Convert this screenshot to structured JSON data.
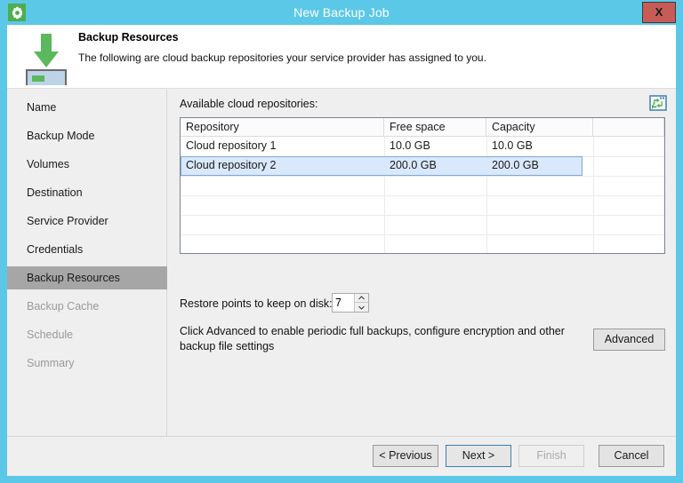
{
  "window": {
    "title": "New Backup Job",
    "app_icon": "gear-icon",
    "close_label": "X",
    "accent_color": "#5cc8e8",
    "close_color": "#c75b56"
  },
  "header": {
    "title": "Backup Resources",
    "description": "The following are cloud backup repositories your service provider has assigned to you.",
    "icon": "download-to-disk-icon"
  },
  "sidebar": {
    "items": [
      {
        "label": "Name",
        "state": "enabled"
      },
      {
        "label": "Backup Mode",
        "state": "enabled"
      },
      {
        "label": "Volumes",
        "state": "enabled"
      },
      {
        "label": "Destination",
        "state": "enabled"
      },
      {
        "label": "Service Provider",
        "state": "enabled"
      },
      {
        "label": "Credentials",
        "state": "enabled"
      },
      {
        "label": "Backup Resources",
        "state": "selected"
      },
      {
        "label": "Backup Cache",
        "state": "disabled"
      },
      {
        "label": "Schedule",
        "state": "disabled"
      },
      {
        "label": "Summary",
        "state": "disabled"
      }
    ]
  },
  "main": {
    "repositories_label": "Available cloud repositories:",
    "refresh_icon": "refresh-icon",
    "table": {
      "columns": [
        "Repository",
        "Free space",
        "Capacity",
        ""
      ],
      "rows": [
        {
          "repository": "Cloud repository 1",
          "free_space": "10.0 GB",
          "capacity": "10.0 GB",
          "selected": false
        },
        {
          "repository": "Cloud repository 2",
          "free_space": "200.0 GB",
          "capacity": "200.0 GB",
          "selected": true
        }
      ],
      "empty_rows": 5,
      "selection_color": "#d9e8fb"
    },
    "restore_points": {
      "label": "Restore points to keep on disk:",
      "value": "7",
      "spinner_up_icon": "chevron-up-icon",
      "spinner_down_icon": "chevron-down-icon"
    },
    "advanced": {
      "description": "Click Advanced to enable periodic full backups, configure encryption and other backup file settings",
      "button_label": "Advanced"
    }
  },
  "footer": {
    "buttons": [
      {
        "label": "< Previous",
        "state": "enabled"
      },
      {
        "label": "Next >",
        "state": "focused"
      },
      {
        "label": "Finish",
        "state": "disabled"
      },
      {
        "label": "Cancel",
        "state": "enabled"
      }
    ]
  }
}
